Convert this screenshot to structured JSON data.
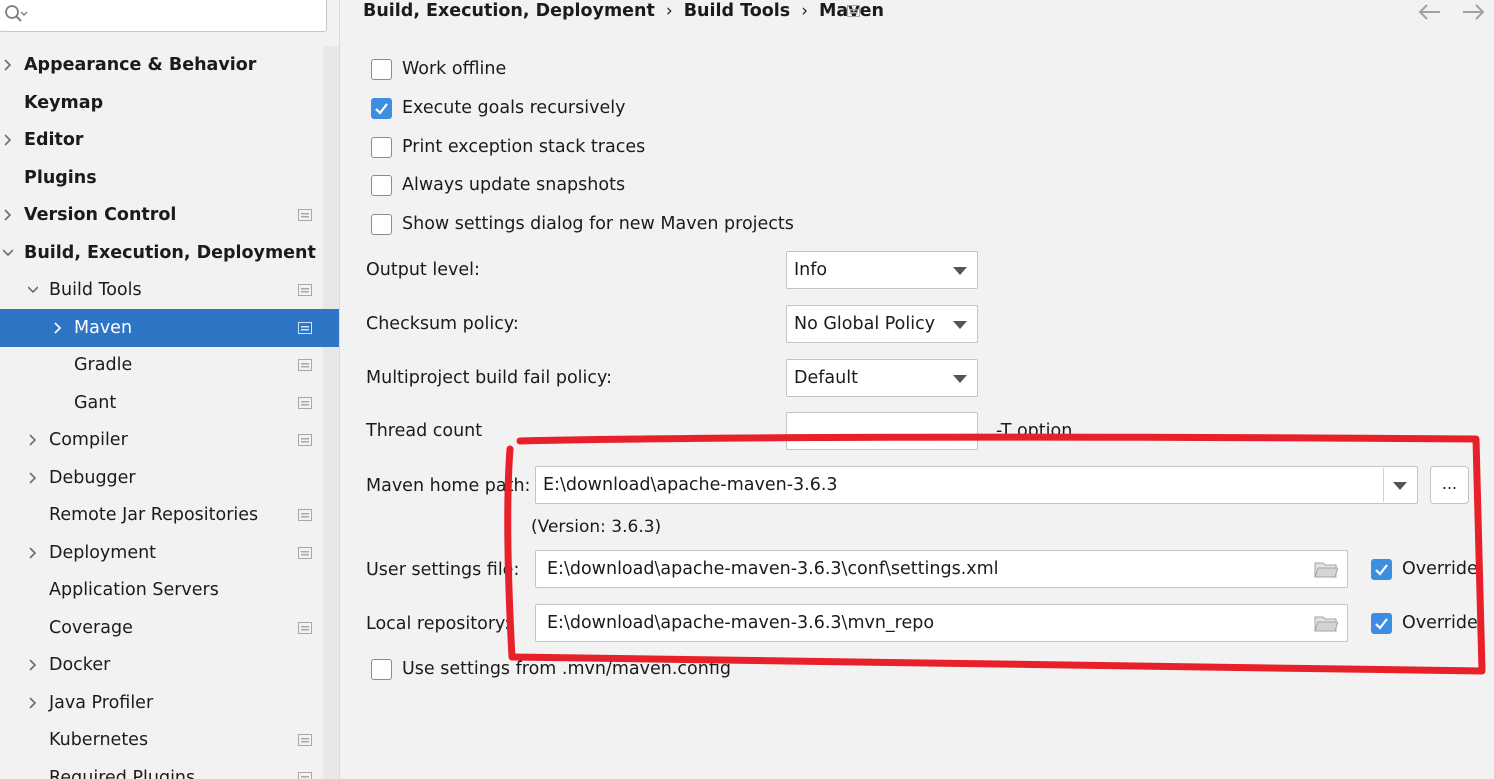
{
  "sidebar": {
    "items": [
      {
        "label": "Appearance & Behavior",
        "level": 0,
        "expandable": true,
        "expanded": false,
        "bold": true,
        "project_icon": false
      },
      {
        "label": "Keymap",
        "level": 0,
        "expandable": false,
        "bold": true,
        "project_icon": false
      },
      {
        "label": "Editor",
        "level": 0,
        "expandable": true,
        "expanded": false,
        "bold": true,
        "project_icon": false
      },
      {
        "label": "Plugins",
        "level": 0,
        "expandable": false,
        "bold": true,
        "project_icon": false
      },
      {
        "label": "Version Control",
        "level": 0,
        "expandable": true,
        "expanded": false,
        "bold": true,
        "project_icon": true
      },
      {
        "label": "Build, Execution, Deployment",
        "level": 0,
        "expandable": true,
        "expanded": true,
        "bold": true,
        "project_icon": false
      },
      {
        "label": "Build Tools",
        "level": 1,
        "expandable": true,
        "expanded": true,
        "bold": false,
        "project_icon": true
      },
      {
        "label": "Maven",
        "level": 2,
        "expandable": true,
        "expanded": false,
        "bold": false,
        "project_icon": true,
        "selected": true
      },
      {
        "label": "Gradle",
        "level": 2,
        "expandable": false,
        "bold": false,
        "project_icon": true
      },
      {
        "label": "Gant",
        "level": 2,
        "expandable": false,
        "bold": false,
        "project_icon": true
      },
      {
        "label": "Compiler",
        "level": 1,
        "expandable": true,
        "expanded": false,
        "bold": false,
        "project_icon": true
      },
      {
        "label": "Debugger",
        "level": 1,
        "expandable": true,
        "expanded": false,
        "bold": false,
        "project_icon": false
      },
      {
        "label": "Remote Jar Repositories",
        "level": 1,
        "expandable": false,
        "bold": false,
        "project_icon": true
      },
      {
        "label": "Deployment",
        "level": 1,
        "expandable": true,
        "expanded": false,
        "bold": false,
        "project_icon": true
      },
      {
        "label": "Application Servers",
        "level": 1,
        "expandable": false,
        "bold": false,
        "project_icon": false
      },
      {
        "label": "Coverage",
        "level": 1,
        "expandable": false,
        "bold": false,
        "project_icon": true
      },
      {
        "label": "Docker",
        "level": 1,
        "expandable": true,
        "expanded": false,
        "bold": false,
        "project_icon": false
      },
      {
        "label": "Java Profiler",
        "level": 1,
        "expandable": true,
        "expanded": false,
        "bold": false,
        "project_icon": false
      },
      {
        "label": "Kubernetes",
        "level": 1,
        "expandable": false,
        "bold": false,
        "project_icon": true
      },
      {
        "label": "Required Plugins",
        "level": 1,
        "expandable": false,
        "bold": false,
        "project_icon": true
      }
    ]
  },
  "breadcrumb": {
    "parts": [
      "Build, Execution, Deployment",
      "Build Tools",
      "Maven"
    ],
    "separator": "›"
  },
  "options": {
    "work_offline": {
      "label": "Work offline",
      "checked": false
    },
    "execute_goals": {
      "label": "Execute goals recursively",
      "checked": true
    },
    "print_exception": {
      "label": "Print exception stack traces",
      "checked": false
    },
    "always_update": {
      "label": "Always update snapshots",
      "checked": false
    },
    "show_settings": {
      "label": "Show settings dialog for new Maven projects",
      "checked": false
    },
    "use_mvn_config": {
      "label": "Use settings from .mvn/maven.config",
      "checked": false
    }
  },
  "form": {
    "output_level": {
      "label": "Output level:",
      "value": "Info"
    },
    "checksum_policy": {
      "label": "Checksum policy:",
      "value": "No Global Policy"
    },
    "fail_policy": {
      "label": "Multiproject build fail policy:",
      "value": "Default"
    },
    "thread_count": {
      "label": "Thread count",
      "value": "",
      "suffix": "-T option"
    },
    "maven_home": {
      "label": "Maven home path:",
      "value": "E:\\download\\apache-maven-3.6.3",
      "browse_label": "...",
      "version": "(Version: 3.6.3)"
    },
    "user_settings": {
      "label": "User settings file:",
      "value": "E:\\download\\apache-maven-3.6.3\\conf\\settings.xml",
      "override_label": "Override",
      "override_checked": true
    },
    "local_repo": {
      "label": "Local repository:",
      "value": "E:\\download\\apache-maven-3.6.3\\mvn_repo",
      "override_label": "Override",
      "override_checked": true
    }
  },
  "colors": {
    "selection": "#2f75c5",
    "checkbox_checked": "#3d8ee0",
    "highlight_annotation": "#e8202a"
  },
  "icons": {
    "search": "search-icon",
    "expand": "chevron-right-icon",
    "collapse": "chevron-down-icon",
    "project_scope": "project-scope-icon",
    "back": "arrow-left-icon",
    "forward": "arrow-right-icon",
    "folder": "folder-icon",
    "dropdown": "dropdown-arrow-icon"
  }
}
